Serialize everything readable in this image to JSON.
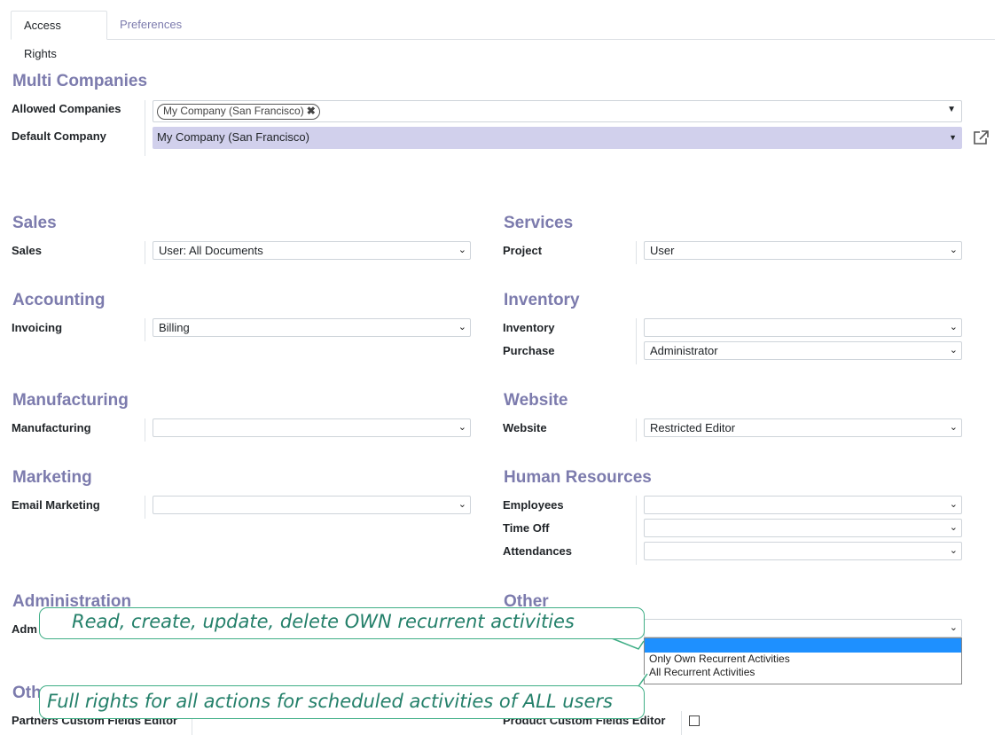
{
  "tabs": {
    "access_rights": "Access Rights",
    "preferences": "Preferences"
  },
  "multi_companies": {
    "heading": "Multi Companies",
    "allowed_label": "Allowed Companies",
    "allowed_tag": "My Company (San Francisco)",
    "default_label": "Default Company",
    "default_value": "My Company (San Francisco)"
  },
  "sales": {
    "heading": "Sales",
    "field_label": "Sales",
    "value": "User: All Documents"
  },
  "services": {
    "heading": "Services",
    "field_label": "Project",
    "value": "User"
  },
  "accounting": {
    "heading": "Accounting",
    "field_label": "Invoicing",
    "value": "Billing"
  },
  "inventory": {
    "heading": "Inventory",
    "inventory_label": "Inventory",
    "inventory_value": "",
    "purchase_label": "Purchase",
    "purchase_value": "Administrator"
  },
  "manufacturing": {
    "heading": "Manufacturing",
    "field_label": "Manufacturing",
    "value": ""
  },
  "website": {
    "heading": "Website",
    "field_label": "Website",
    "value": "Restricted Editor"
  },
  "marketing": {
    "heading": "Marketing",
    "field_label": "Email Marketing",
    "value": ""
  },
  "hr": {
    "heading": "Human Resources",
    "employees_label": "Employees",
    "timeoff_label": "Time Off",
    "attendances_label": "Attendances"
  },
  "administration": {
    "heading": "Administration",
    "field_label_partial": "Adm"
  },
  "other": {
    "heading": "Other"
  },
  "other_bottom": {
    "heading_partial": "Oth",
    "partners_label": "Partners Custom Fields Editor",
    "product_label": "Product Custom Fields Editor"
  },
  "dropdown": {
    "options": [
      "",
      "Only Own Recurrent Activities",
      "All Recurrent Activities"
    ]
  },
  "callouts": {
    "own": "Read, create, update, delete OWN recurrent activities",
    "all": "Full rights for all actions for scheduled activities of ALL users"
  },
  "colors": {
    "accent": "#7c7bad",
    "highlight": "#d1d0ec",
    "callout": "#3fae86",
    "selection": "#1e90ff"
  }
}
